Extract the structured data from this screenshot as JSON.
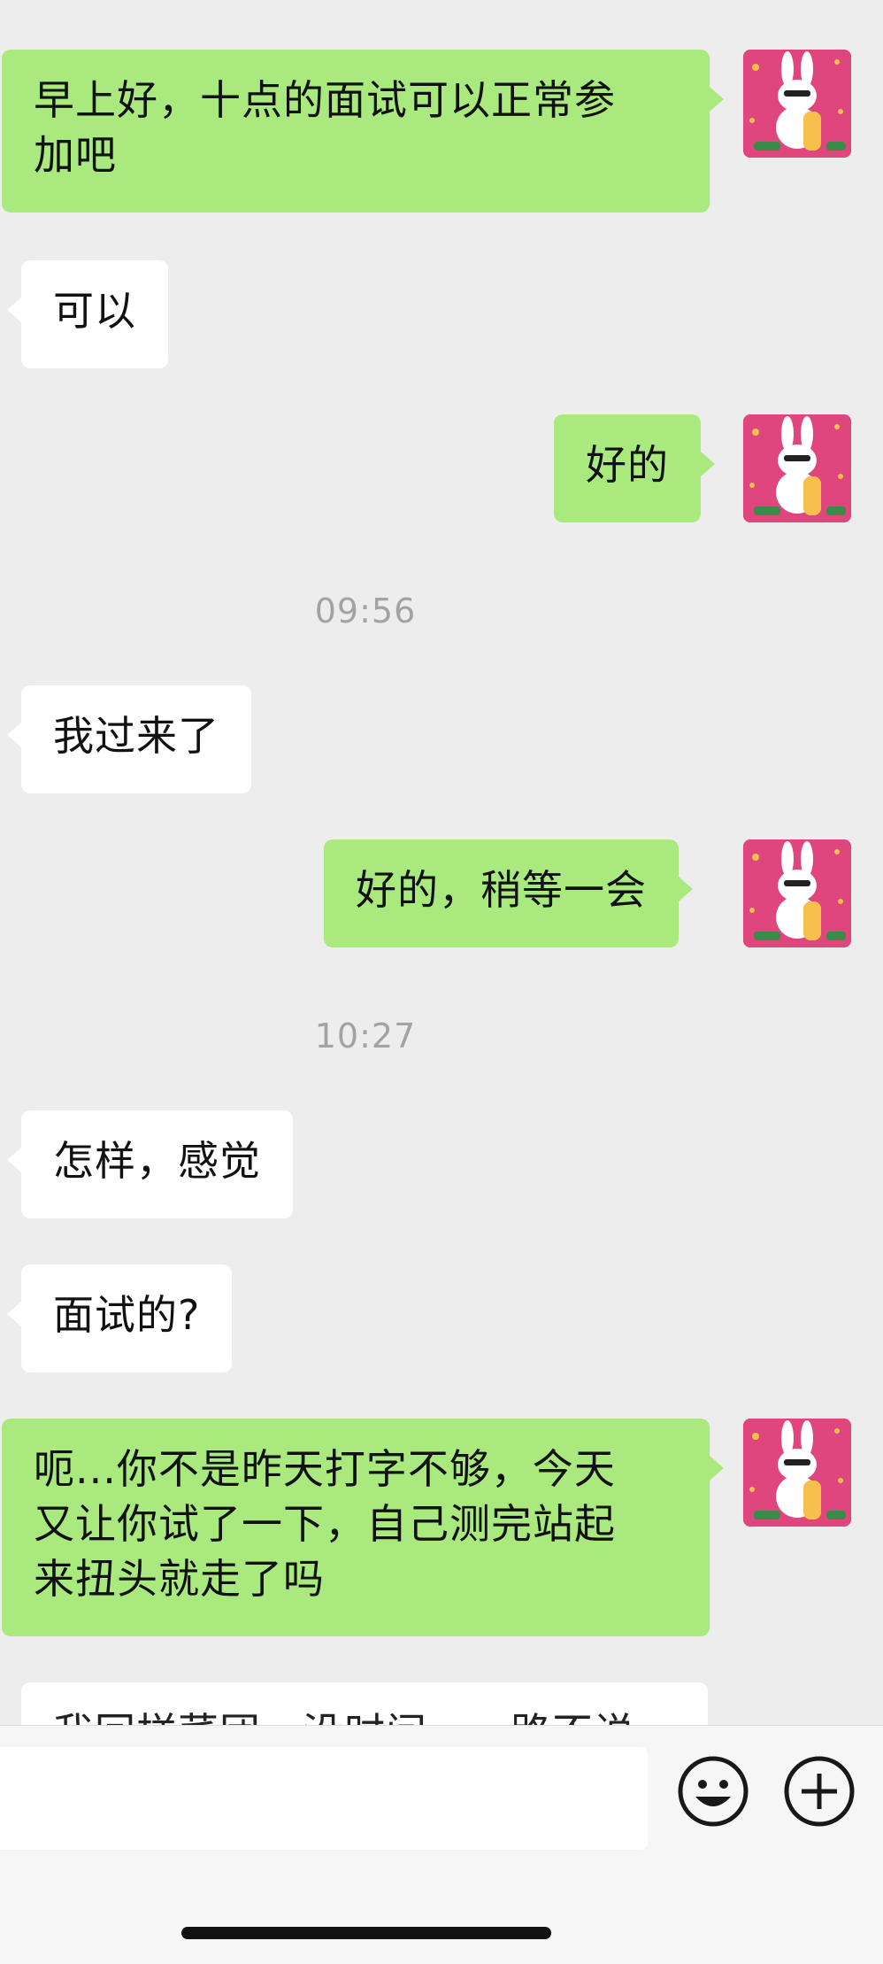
{
  "messages": [
    {
      "side": "sent",
      "text": "早上好，十点的面试可以正常参\n加吧"
    },
    {
      "side": "recv",
      "text": "可以"
    },
    {
      "side": "sent",
      "text": "好的"
    },
    {
      "timestamp": "09:56"
    },
    {
      "side": "recv",
      "text": "我过来了"
    },
    {
      "side": "sent",
      "text": "好的，稍等一会"
    },
    {
      "timestamp": "10:27"
    },
    {
      "side": "recv",
      "text": "怎样，感觉"
    },
    {
      "side": "recv",
      "text": "面试的?"
    },
    {
      "side": "sent",
      "text": "呃...你不是昨天打字不够，今天\n又让你试了一下，自己测完站起\n来扭头就走了吗"
    },
    {
      "side": "recv",
      "text": "我回样菜团，没时间，一路不说",
      "partial": true
    }
  ],
  "input": {
    "value": "",
    "placeholder": ""
  },
  "icons": {
    "emoji": "smiley-icon",
    "more": "plus-circle-icon",
    "avatar": "rabbit-avatar-icon"
  },
  "colors": {
    "sent_bubble": "#a9e97e",
    "recv_bubble": "#ffffff",
    "background": "#ededed",
    "avatar_bg": "#e0467e"
  }
}
